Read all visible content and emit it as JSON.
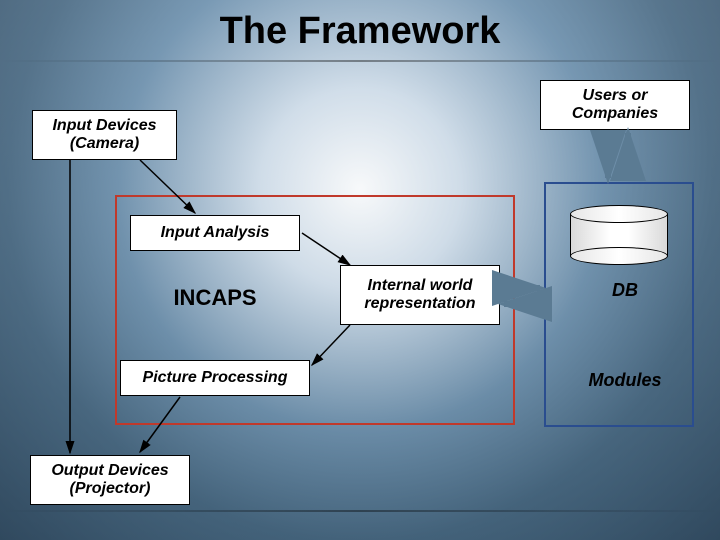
{
  "title": "The Framework",
  "boxes": {
    "input_devices": "Input Devices\n(Camera)",
    "users": "Users or\nCompanies",
    "input_analysis": "Input Analysis",
    "incaps": "INCAPS",
    "internal_world": "Internal world\nrepresentation",
    "picture_processing": "Picture Processing",
    "output_devices": "Output Devices\n(Projector)"
  },
  "labels": {
    "db": "DB",
    "modules": "Modules"
  }
}
